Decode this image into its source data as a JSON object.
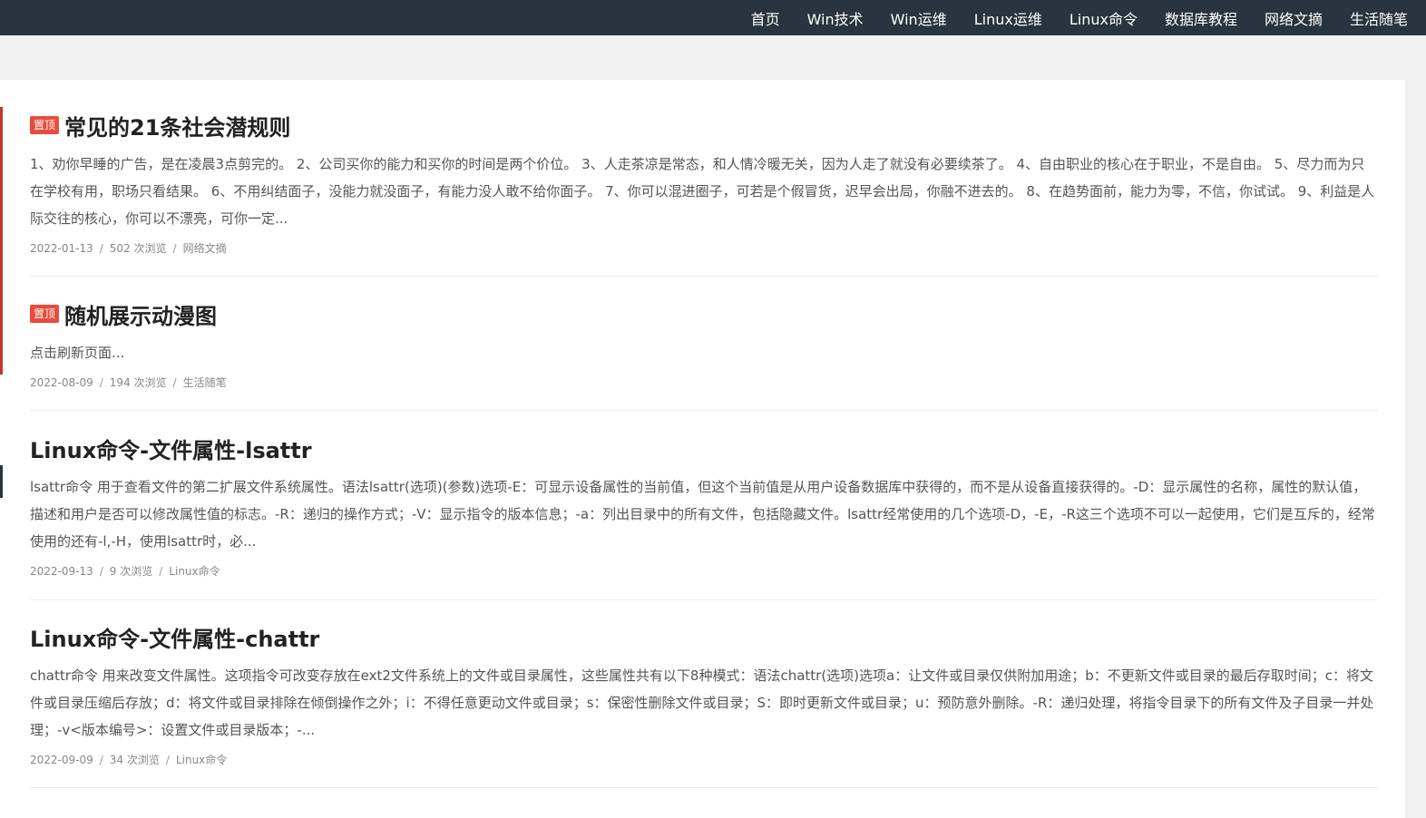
{
  "nav": {
    "items": [
      "首页",
      "Win技术",
      "Win运维",
      "Linux运维",
      "Linux命令",
      "数据库教程",
      "网络文摘",
      "生活随笔"
    ]
  },
  "sticky_label": "置顶",
  "posts": [
    {
      "title": "常见的21条社会潜规则",
      "sticky": true,
      "excerpt": "1、劝你早睡的广告，是在凌晨3点剪完的。 2、公司买你的能力和买你的时间是两个价位。 3、人走茶凉是常态，和人情冷暖无关，因为人走了就没有必要续茶了。 4、自由职业的核心在于职业，不是自由。 5、尽力而为只在学校有用，职场只看结果。 6、不用纠结面子，没能力就没面子，有能力没人敢不给你面子。 7、你可以混进圈子，可若是个假冒货，迟早会出局，你融不进去的。 8、在趋势面前，能力为零，不信，你试试。 9、利益是人际交往的核心，你可以不漂亮，可你一定...",
      "date": "2022-01-13",
      "views": "502 次浏览",
      "category": "网络文摘"
    },
    {
      "title": "随机展示动漫图",
      "sticky": true,
      "excerpt": "点击刷新页面...",
      "date": "2022-08-09",
      "views": "194 次浏览",
      "category": "生活随笔"
    },
    {
      "title": "Linux命令-文件属性-lsattr",
      "sticky": false,
      "excerpt": "lsattr命令 用于查看文件的第二扩展文件系统属性。语法lsattr(选项)(参数)选项-E：可显示设备属性的当前值，但这个当前值是从用户设备数据库中获得的，而不是从设备直接获得的。-D：显示属性的名称，属性的默认值，描述和用户是否可以修改属性值的标志。-R：递归的操作方式；-V：显示指令的版本信息；-a：列出目录中的所有文件，包括隐藏文件。lsattr经常使用的几个选项-D，-E，-R这三个选项不可以一起使用，它们是互斥的，经常使用的还有-l,-H，使用lsattr时，必...",
      "date": "2022-09-13",
      "views": "9 次浏览",
      "category": "Linux命令"
    },
    {
      "title": "Linux命令-文件属性-chattr",
      "sticky": false,
      "excerpt": "chattr命令 用来改变文件属性。这项指令可改变存放在ext2文件系统上的文件或目录属性，这些属性共有以下8种模式：语法chattr(选项)选项a：让文件或目录仅供附加用途；b：不更新文件或目录的最后存取时间；c：将文件或目录压缩后存放；d：将文件或目录排除在倾倒操作之外；i：不得任意更动文件或目录；s：保密性删除文件或目录；S：即时更新文件或目录；u：预防意外删除。-R：递归处理，将指令目录下的所有文件及子目录一并处理；-v<版本编号>：设置文件或目录版本；-...",
      "date": "2022-09-09",
      "views": "34 次浏览",
      "category": "Linux命令"
    }
  ],
  "meta_separator": "/"
}
